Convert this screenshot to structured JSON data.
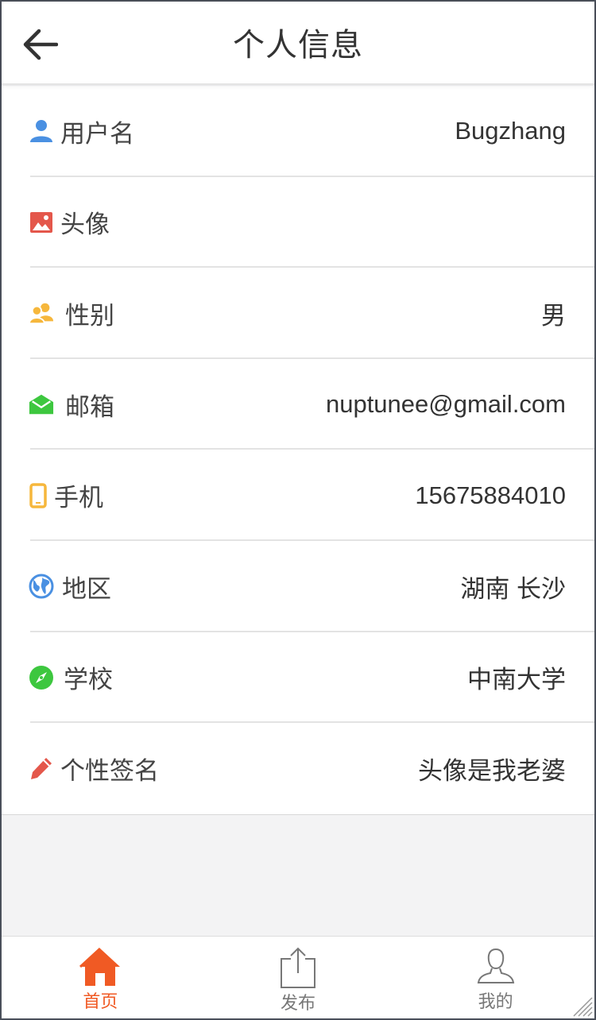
{
  "header": {
    "title": "个人信息",
    "back_icon": "arrow-left-icon"
  },
  "rows": [
    {
      "key": "username",
      "icon": "user-icon",
      "icon_color": "#4a90e2",
      "label": "用户名",
      "value": "Bugzhang"
    },
    {
      "key": "avatar",
      "icon": "image-icon",
      "icon_color": "#e4574b",
      "label": "头像",
      "value": ""
    },
    {
      "key": "gender",
      "icon": "people-icon",
      "icon_color": "#f6b73c",
      "label": "性别",
      "value": "男"
    },
    {
      "key": "email",
      "icon": "mail-open-icon",
      "icon_color": "#3dc73f",
      "label": "邮箱",
      "value": "nuptunee@gmail.com"
    },
    {
      "key": "phone",
      "icon": "phone-icon",
      "icon_color": "#f6b73c",
      "label": "手机",
      "value": "15675884010"
    },
    {
      "key": "region",
      "icon": "globe-icon",
      "icon_color": "#4a90e2",
      "label": "地区",
      "value": "湖南 长沙"
    },
    {
      "key": "school",
      "icon": "compass-icon",
      "icon_color": "#3dc73f",
      "label": "学校",
      "value": "中南大学"
    },
    {
      "key": "signature",
      "icon": "pencil-icon",
      "icon_color": "#e4574b",
      "label": "个性签名",
      "value": "头像是我老婆"
    }
  ],
  "tabbar": {
    "active_color": "#f05a24",
    "items": [
      {
        "label": "首页",
        "icon": "home-icon",
        "active": true
      },
      {
        "label": "发布",
        "icon": "share-upload-icon",
        "active": false
      },
      {
        "label": "我的",
        "icon": "person-outline-icon",
        "active": false
      }
    ]
  }
}
